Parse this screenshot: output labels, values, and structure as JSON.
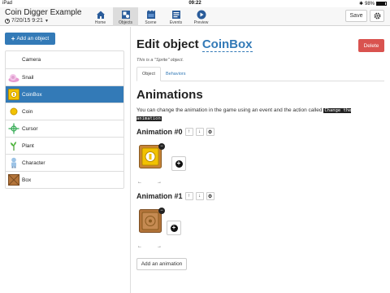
{
  "status_bar": {
    "carrier": "iPad",
    "time": "09:22",
    "battery": "98%"
  },
  "project": {
    "title": "Coin Digger Example",
    "date": "7/20/15 9:21"
  },
  "nav_tabs": [
    {
      "label": "Home",
      "icon": "home-icon"
    },
    {
      "label": "Objects",
      "icon": "objects-icon",
      "active": true
    },
    {
      "label": "Scene",
      "icon": "scene-icon"
    },
    {
      "label": "Events",
      "icon": "events-icon"
    },
    {
      "label": "Preview",
      "icon": "preview-icon"
    }
  ],
  "toolbar": {
    "save_label": "Save"
  },
  "left_panel": {
    "add_object_label": "Add an object",
    "objects": [
      {
        "name": "Camera",
        "icon": "camera-icon"
      },
      {
        "name": "Snail",
        "icon": "snail-icon"
      },
      {
        "name": "CoinBox",
        "icon": "coinbox-icon",
        "selected": true
      },
      {
        "name": "Coin",
        "icon": "coin-icon"
      },
      {
        "name": "Cursor",
        "icon": "cursor-icon"
      },
      {
        "name": "Plant",
        "icon": "plant-icon"
      },
      {
        "name": "Character",
        "icon": "character-icon"
      },
      {
        "name": "Box",
        "icon": "box-icon"
      }
    ]
  },
  "editor": {
    "title_prefix": "Edit object",
    "object_name": "CoinBox",
    "subtitle": "This is a \"Sprite\" object.",
    "delete_label": "Delete",
    "tabs": {
      "object": "Object",
      "behaviors": "Behaviors"
    },
    "animations_heading": "Animations",
    "animations_desc": "You can change the animation in the game using an event and the action called",
    "animations_code": "Change the animation",
    "animations": [
      {
        "label": "Animation #0"
      },
      {
        "label": "Animation #1"
      }
    ],
    "add_animation_label": "Add an animation"
  },
  "colors": {
    "accent": "#337ab7",
    "danger": "#d9534f",
    "coin_yellow": "#f2c200",
    "box_brown": "#b3743a"
  }
}
